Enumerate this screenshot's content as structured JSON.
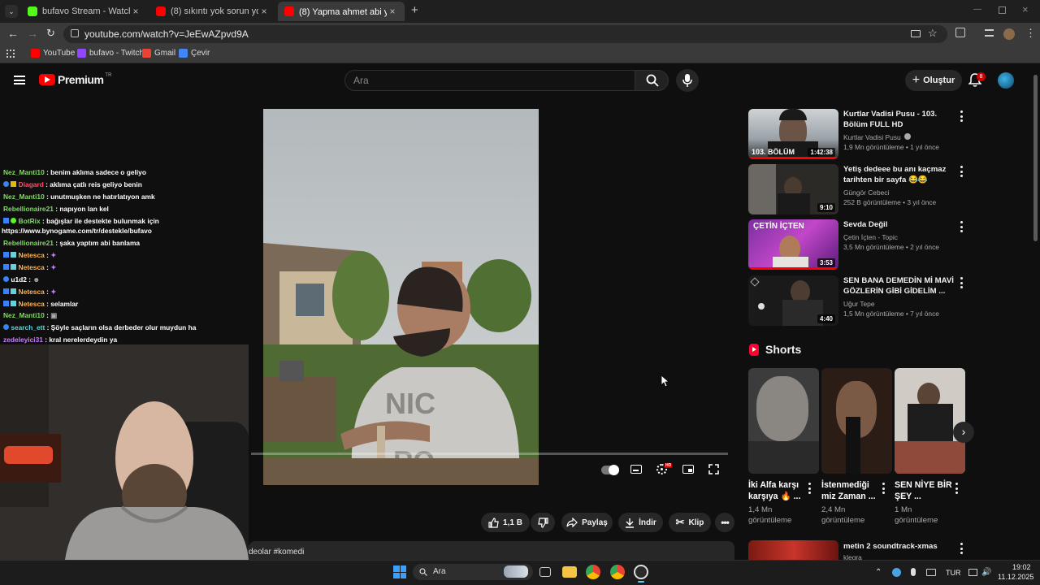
{
  "browser": {
    "tabs": [
      {
        "title": "bufavo Stream - Watch Live on",
        "favicon_color": "#53fc18"
      },
      {
        "title": "(8) sıkıntı yok sorun yok derbed",
        "favicon_color": "#ff0000"
      },
      {
        "title": "(8) Yapma ahmet abi yanarız 😂",
        "favicon_color": "#ff0000"
      }
    ],
    "url": "youtube.com/watch?v=JeEwAZpvd9A",
    "bookmarks": [
      {
        "label": "YouTube",
        "color": "#ff0000"
      },
      {
        "label": "bufavo - Twitch",
        "color": "#9146ff"
      },
      {
        "label": "Gmail",
        "color": "#ea4335"
      },
      {
        "label": "Çevir",
        "color": "#4285f4"
      }
    ]
  },
  "youtube": {
    "logo_text": "Premium",
    "region": "TR",
    "search_placeholder": "Ara",
    "create_label": "Oluştur",
    "notification_count": "8",
    "like_count": "1,1 B",
    "share_label": "Paylaş",
    "download_label": "İndir",
    "clip_label": "Klip",
    "description_snippet": "deolar #komedi",
    "hd_badge": "HD"
  },
  "chat": [
    {
      "user": "Nez_Manti10",
      "color": "#7fdc5f",
      "text": ": benim aklıma sadece o geliyo"
    },
    {
      "user": "Diagard",
      "color": "#ff4b6e",
      "text": ": aklıma çatlı reis geliyo benin"
    },
    {
      "user": "Nez_Manti10",
      "color": "#7fdc5f",
      "text": ": unutmuşken ne hatırlatıyon amk"
    },
    {
      "user": "Rebellionaire21",
      "color": "#7fdc5f",
      "text": ": napıyon lan kel"
    },
    {
      "user": "BotRix",
      "color": "#7fdc5f",
      "text": ": bağışlar ile destekte bulunmak için"
    },
    {
      "user": "",
      "color": "#ffffff",
      "text": "https://www.bynogame.com/tr/destekle/bufavo"
    },
    {
      "user": "Rebellionaire21",
      "color": "#7fdc5f",
      "text": ": şaka yaptım abi banlama"
    },
    {
      "user": "Netesca",
      "color": "#ffb347",
      "text": ":"
    },
    {
      "user": "Netesca",
      "color": "#ffb347",
      "text": ":"
    },
    {
      "user": "u1d2",
      "color": "#ffffff",
      "text": ":"
    },
    {
      "user": "Netesca",
      "color": "#ffb347",
      "text": ":"
    },
    {
      "user": "Netesca",
      "color": "#ffb347",
      "text": ": selamlar"
    },
    {
      "user": "Nez_Manti10",
      "color": "#7fdc5f",
      "text": ":"
    },
    {
      "user": "search_ett",
      "color": "#5fd4dc",
      "text": ": Şöyle saçların olsa derbeder olur muydun ha"
    },
    {
      "user": "zedeleyici31",
      "color": "#c97cff",
      "text": ": kral nerelerdeydin ya"
    }
  ],
  "recommendations": [
    {
      "title": "Kurtlar Vadisi Pusu - 103. Bölüm FULL HD",
      "channel": "Kurtlar Vadisi Pusu",
      "meta": "1,9 Mn görüntüleme • 1 yıl önce",
      "duration": "1:42:38",
      "thumb_text": "103. BÖLÜM"
    },
    {
      "title": "Yetiş dedeee bu anı kaçmaz tarihten bir sayfa 😂😂",
      "channel": "Güngör Cebeci",
      "meta": "252 B görüntüleme • 3 yıl önce",
      "duration": "9:10",
      "thumb_text": ""
    },
    {
      "title": "Sevda Değil",
      "channel": "Çetin İçten - Topic",
      "meta": "3,5 Mn görüntüleme • 2 yıl önce",
      "duration": "3:53",
      "thumb_text": "ÇETİN İÇTEN"
    },
    {
      "title": "SEN BANA DEMEDİN Mİ MAVİ GÖZLERİN GİBİ GİDELİM ...",
      "channel": "Uğur Tepe",
      "meta": "1,5 Mn görüntüleme • 7 yıl önce",
      "duration": "4:40",
      "thumb_text": ""
    }
  ],
  "shorts": {
    "heading": "Shorts",
    "items": [
      {
        "title": "İki Alfa karşı karşıya 🔥 ...",
        "views": "1,4 Mn",
        "label": "görüntüleme"
      },
      {
        "title": "İstenmediği miz Zaman ...",
        "views": "2,4 Mn",
        "label": "görüntüleme"
      },
      {
        "title": "SEN NİYE BİR ŞEY ...",
        "views": "1 Mn",
        "label": "görüntüleme"
      }
    ]
  },
  "next_item": {
    "title": "metin 2 soundtrack-xmas",
    "channel": "klegra"
  },
  "taskbar": {
    "search_label": "Ara",
    "language": "TUR",
    "time": "19:02",
    "date": "11.12.2025"
  }
}
